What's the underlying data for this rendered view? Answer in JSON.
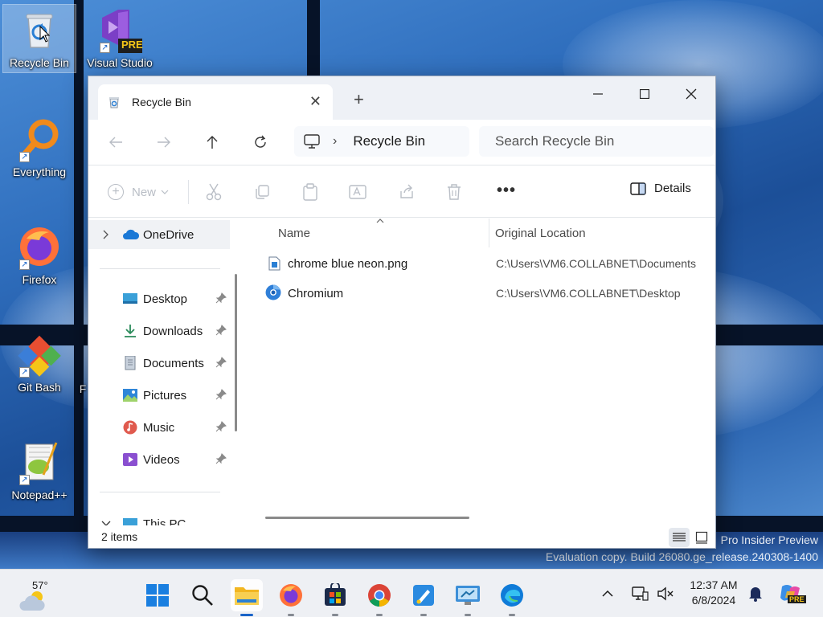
{
  "desktop": {
    "icons": [
      {
        "label": "Recycle Bin"
      },
      {
        "label": "Visual Studio",
        "badge": "PRE"
      },
      {
        "label": "Everything"
      },
      {
        "label": "Firefox"
      },
      {
        "label": "Git Bash"
      },
      {
        "label": "F"
      },
      {
        "label": "Notepad++"
      }
    ],
    "watermark": {
      "line1": "Pro Insider Preview",
      "line2": "Evaluation copy. Build 26080.ge_release.240308-1400"
    }
  },
  "explorer": {
    "tab_title": "Recycle Bin",
    "new_tab_glyph": "+",
    "close_tab_glyph": "✕",
    "breadcrumb": {
      "separator": "›",
      "current": "Recycle Bin"
    },
    "search_placeholder": "Search Recycle Bin",
    "commands": {
      "new_label": "New",
      "more_label": "•••",
      "details_label": "Details"
    },
    "nav": {
      "onedrive": "OneDrive",
      "quick_access": [
        {
          "label": "Desktop",
          "icon": "desktop-icon"
        },
        {
          "label": "Downloads",
          "icon": "download-icon"
        },
        {
          "label": "Documents",
          "icon": "documents-icon"
        },
        {
          "label": "Pictures",
          "icon": "pictures-icon"
        },
        {
          "label": "Music",
          "icon": "music-icon"
        },
        {
          "label": "Videos",
          "icon": "videos-icon"
        }
      ],
      "this_pc": "This PC"
    },
    "columns": {
      "name": "Name",
      "original_location": "Original Location"
    },
    "rows": [
      {
        "name": "chrome blue neon.png",
        "location": "C:\\Users\\VM6.COLLABNET\\Documents",
        "icon": "image-file-icon"
      },
      {
        "name": "Chromium",
        "location": "C:\\Users\\VM6.COLLABNET\\Desktop",
        "icon": "chromium-icon"
      }
    ],
    "status": "2 items"
  },
  "taskbar": {
    "weather_temp": "57°",
    "clock_time": "12:37 AM",
    "clock_date": "6/8/2024",
    "apps": [
      "start",
      "search",
      "file-explorer",
      "firefox",
      "store",
      "chrome",
      "paint",
      "remote-desktop",
      "edge"
    ],
    "copilot_badge": "PRE"
  }
}
